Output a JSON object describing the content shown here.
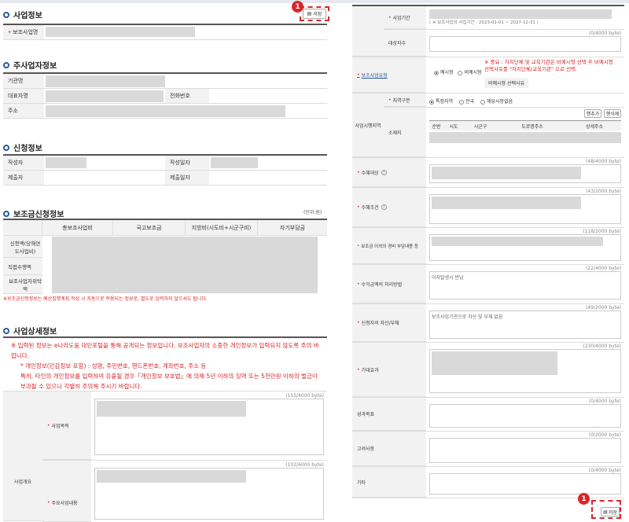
{
  "left": {
    "biz": {
      "title": "사업정보",
      "save": "저장",
      "name_label": "보조사업명"
    },
    "host": {
      "title": "주사업자정보",
      "org": "기관명",
      "ceo": "대표자명",
      "phone": "전화번호",
      "addr": "주소"
    },
    "apply": {
      "title": "신청정보",
      "writer": "작성자",
      "write_date": "작성일자",
      "submitter": "제출자",
      "submit_date": "제출일자"
    },
    "grant": {
      "title": "보조금신청정보",
      "unit": "(단위:원)",
      "headers": [
        "총보조사업비",
        "국고보조금",
        "지방비(시도비+시군구비)",
        "자기부담금"
      ],
      "rows": [
        "신청액(당해연도사업비)",
        "직접수행액",
        "보조사업자위탁액"
      ],
      "note": "※보조금신청정보는 예산집행계획 작성 시 자동으로 적용되는 정보로, 별도로 입력하지 않으셔도 됩니다."
    },
    "detail": {
      "title": "사업상세정보",
      "notice1": "※ 입력된 정보는 e나라도움 대민포털을 통해 공개되는 정보입니다. 보조사업자의 소중한 개인정보가 입력되지 않도록 주의 바랍니다.",
      "notice2": "* 개인정보(민감정보 포함) : 성명, 주민번호, 핸드폰번호, 계좌번호, 주소 등",
      "notice3": "특히, 타인의 개인정보를 입력하여 유출될 경우「개인정보 보호법」에 의해 5년 이하의 징역 또는 5천만원 이하의 벌금이 부과될 수 있으니 각별히 주의해 주시기 바랍니다.",
      "group": "사업개요",
      "purpose": "사업목적",
      "purpose_count": "(155/4000 byte)",
      "content": "주요사업내용",
      "content_count": "(102/6000 byte)"
    }
  },
  "right": {
    "period": "사업기간",
    "period_text": "( ※ 보조사업의 사업기간 : 2023-01-01 ~ 2027-12-31 )",
    "target": "대상자수",
    "target_count": "(0/4000 byte)",
    "recruit": "보조사업유형",
    "radio1": "예시형",
    "radio2": "비예시형",
    "recruit_notice": "※ 중요 : 자치단체 및 교육기관은 비예시형 선택 후 비예시형 선택사유를 \"자치단체/교육기관\" 으로 선택",
    "nonexample": "비예시형 선택사유",
    "area": "사업시행지역",
    "area_type": "지역구분",
    "area_opt1": "특정지역",
    "area_opt2": "전국",
    "area_opt3": "해당사항없음",
    "add": "행추가",
    "del": "행삭제",
    "location": "소재지",
    "loc_headers": [
      "순번",
      "시도",
      "시군구",
      "도로명주소",
      "상세주소"
    ],
    "beneficiary": "수혜대상",
    "beneficiary_count": "(48/4000 byte)",
    "condition": "수혜조건",
    "condition_count": "(43/2000 byte)",
    "burden": "보조금 이외의 경비 부담내용 등",
    "burden_count": "(118/2000 byte)",
    "revenue": "수익금액의 처리방법",
    "revenue_count": "(22/4000 byte)",
    "revenue_text": "이자발생시 반납",
    "asset": "신청자의 자산/부채",
    "asset_count": "(49/2000 byte)",
    "asset_text": "보조사업기관으로 자산 및 부채 없음",
    "effect": "기대효과",
    "effect_count": "(230/4000 byte)",
    "goal": "성과목표",
    "goal_count": "(0/4000 byte)",
    "consider": "고려사항",
    "consider_count": "(0/2000 byte)",
    "etc": "기타",
    "etc_count": "(0/4000 byte)",
    "save": "저장"
  },
  "marker": "1"
}
